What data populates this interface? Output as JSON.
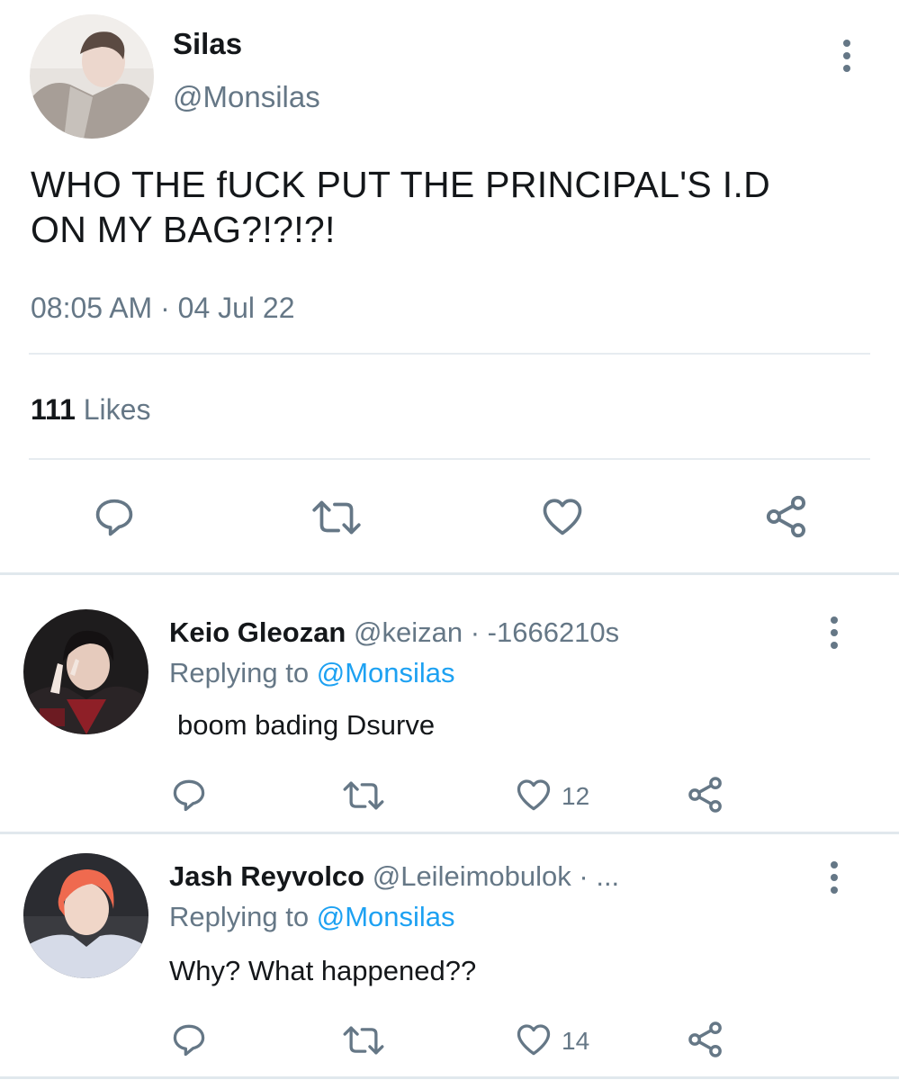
{
  "tweet": {
    "author_name": "Silas",
    "author_handle": "@Monsilas",
    "text_line1": "WHO THE fUCK PUT THE PRINCIPAL'S I.D",
    "text_line2": "ON MY BAG?!?!?!",
    "time": "08:05 AM",
    "separator": "·",
    "date": "04 Jul 22",
    "likes_count": "111",
    "likes_label": "Likes",
    "icons": [
      "reply-icon",
      "retweet-icon",
      "like-icon",
      "share-icon",
      "more-icon"
    ]
  },
  "replies": [
    {
      "name": "Keio Gleozan",
      "handle": "@keizan",
      "time": "· -1666210s",
      "replying_label": "Replying to",
      "replying_to": "@Monsilas",
      "text": "boom bading Dsurve",
      "like_count": "12"
    },
    {
      "name": "Jash Reyvolco",
      "handle": "@Leileimobulok",
      "time": "· ...",
      "replying_label": "Replying to",
      "replying_to": "@Monsilas",
      "text": "Why? What happened??",
      "like_count": "14"
    }
  ],
  "colors": {
    "text": "#14171a",
    "muted": "#657786",
    "link": "#1da1f2",
    "divider": "#e6ecf0"
  }
}
